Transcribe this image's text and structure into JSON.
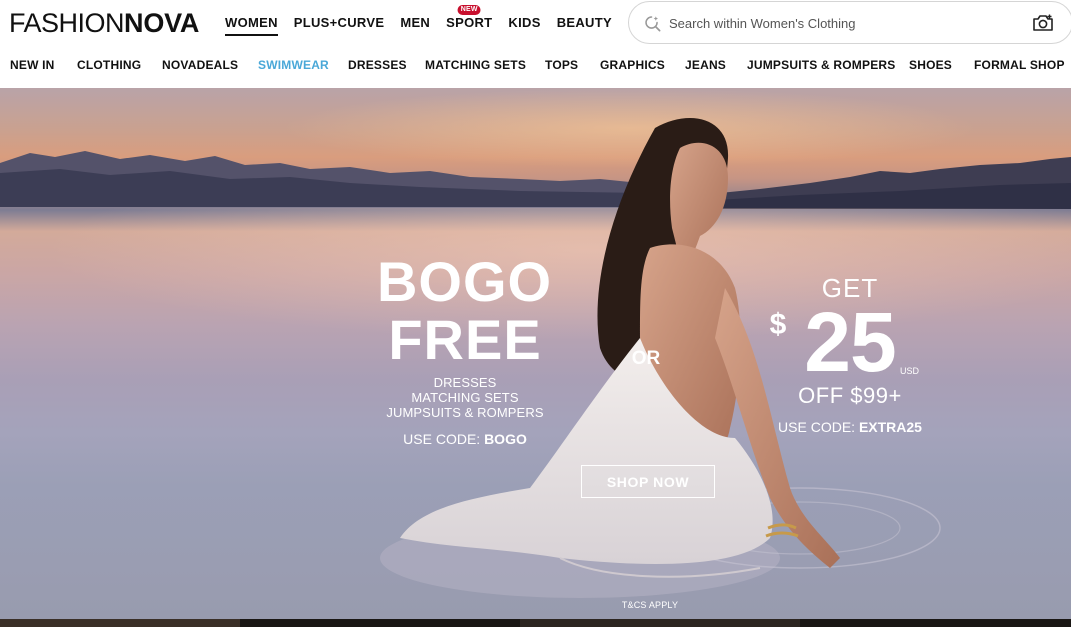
{
  "header": {
    "logo": {
      "part1": "FASHION",
      "part2": "NOVA"
    },
    "main_nav": [
      {
        "label": "WOMEN",
        "active": true
      },
      {
        "label": "PLUS+CURVE"
      },
      {
        "label": "MEN"
      },
      {
        "label": "SPORT",
        "badge": "NEW"
      },
      {
        "label": "KIDS"
      },
      {
        "label": "BEAUTY"
      }
    ],
    "search": {
      "placeholder": "Search within Women's Clothing",
      "value": ""
    }
  },
  "category_nav": [
    {
      "label": "NEW IN"
    },
    {
      "label": "CLOTHING"
    },
    {
      "label": "NOVADEALS"
    },
    {
      "label": "SWIMWEAR",
      "highlighted": true
    },
    {
      "label": "DRESSES"
    },
    {
      "label": "MATCHING SETS"
    },
    {
      "label": "TOPS"
    },
    {
      "label": "GRAPHICS"
    },
    {
      "label": "JEANS"
    },
    {
      "label": "JUMPSUITS & ROMPERS"
    },
    {
      "label": "SHOES"
    },
    {
      "label": "FORMAL SHOP"
    }
  ],
  "hero": {
    "offer1": {
      "line1": "BOGO",
      "line2": "FREE",
      "categories": [
        "DRESSES",
        "MATCHING SETS",
        "JUMPSUITS & ROMPERS"
      ],
      "code_prefix": "USE CODE: ",
      "code": "BOGO"
    },
    "or": "OR",
    "offer2": {
      "get": "GET",
      "currency": "$",
      "amount": "25",
      "unit": "USD",
      "off": "OFF $99+",
      "code_prefix": "USE CODE: ",
      "code": "EXTRA25"
    },
    "cta": "SHOP NOW",
    "terms": "T&CS APPLY"
  },
  "colors": {
    "highlight_nav": "#4aa8d8",
    "badge": "#c8102e",
    "text": "#111111"
  }
}
